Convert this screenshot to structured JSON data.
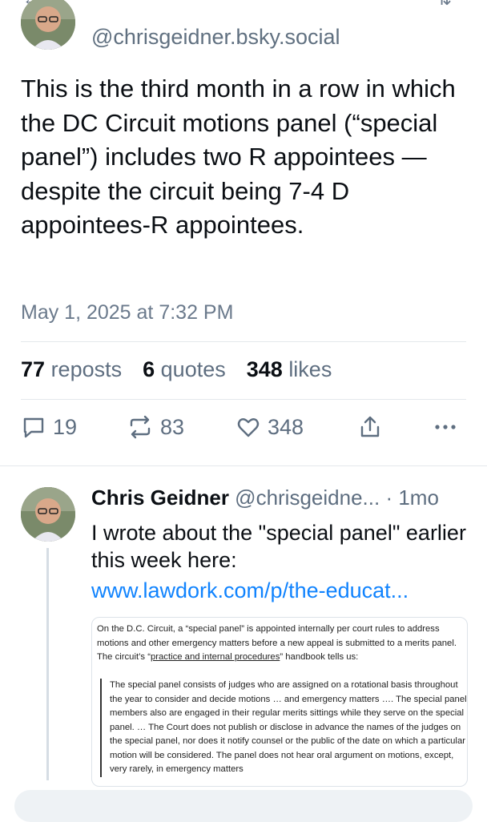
{
  "post": {
    "handle": "@chrisgeidner.bsky.social",
    "text": "This is the third month in a row in which the DC Circuit motions panel (“special panel”) includes two R appointees — despite the circuit being 7-4 D appointees-R appointees.",
    "timestamp": "May 1, 2025 at 7:32 PM",
    "stats": {
      "reposts_count": "77",
      "reposts_label": "reposts",
      "quotes_count": "6",
      "quotes_label": "quotes",
      "likes_count": "348",
      "likes_label": "likes"
    },
    "actions": {
      "reply_count": "19",
      "repost_count": "83",
      "like_count": "348"
    }
  },
  "reply": {
    "name": "Chris Geidner",
    "handle": "@chrisgeidne...",
    "time": "· 1mo",
    "text": "I wrote about the \"special panel\" earlier this week here:",
    "link": "www.lawdork.com/p/the-educat...",
    "embed": {
      "para_before": "On the D.C. Circuit, a “special panel” is appointed internally per court rules to address motions and other emergency matters before a new appeal is submitted to a merits panel. The circuit’s “",
      "para_link": "practice and internal procedures",
      "para_after": "” handbook tells us:",
      "quote": "The special panel consists of judges who are assigned on a rotational basis throughout the year to consider and decide motions … and emergency matters …. The special panel members also are engaged in their regular merits sittings while they serve on the special panel. … The Court does not publish or disclose in advance the names of the judges on the special panel, nor does it notify counsel or the public of the date on which a particular motion will be considered. The panel does not hear oral argument on motions, except, very rarely, in emergency matters"
    }
  },
  "colors": {
    "link": "#1083fe",
    "muted": "#5e6e80",
    "text": "#0b0f14"
  },
  "icons": [
    "reply-icon",
    "repost-icon",
    "like-icon",
    "share-icon",
    "more-icon"
  ]
}
